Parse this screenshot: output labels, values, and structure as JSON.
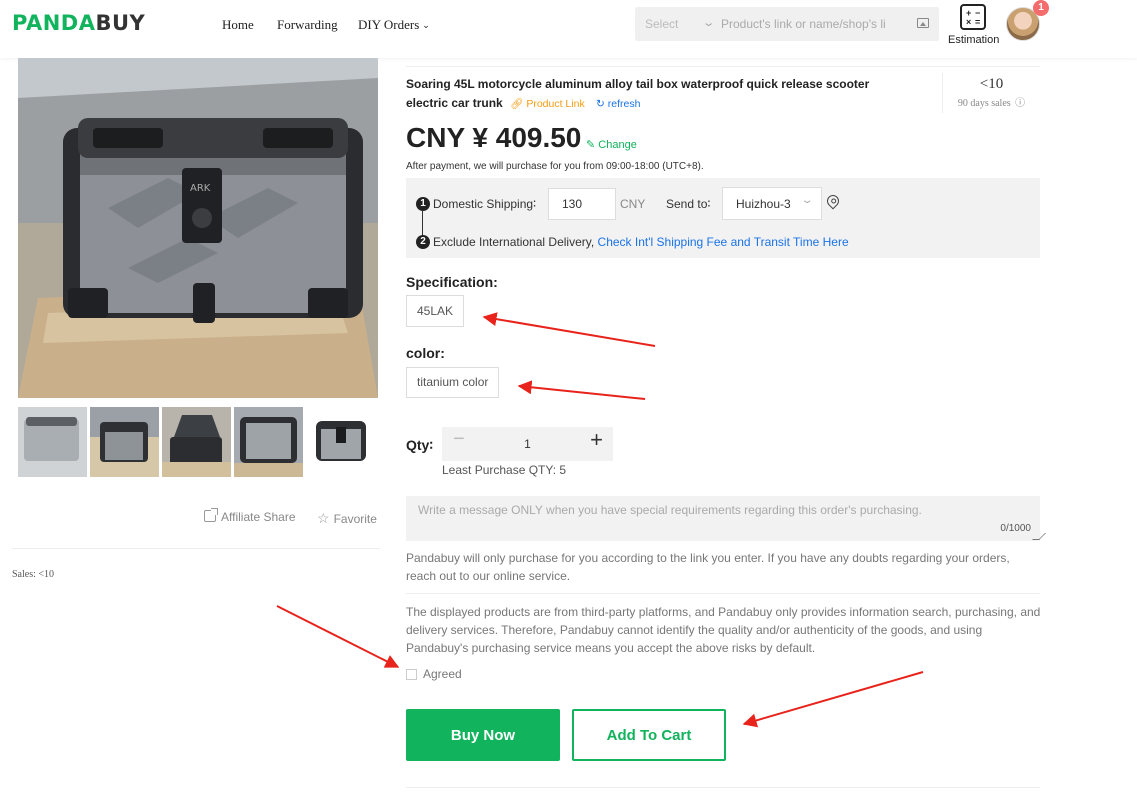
{
  "header": {
    "logo_left": "PANDA",
    "logo_right": "BUY",
    "nav": {
      "home": "Home",
      "forwarding": "Forwarding",
      "diy_orders": "DIY Orders"
    },
    "search": {
      "select_label": "Select",
      "placeholder": "Product's link or name/shop's li"
    },
    "estimation_label": "Estimation",
    "notification_count": "1"
  },
  "gallery": {
    "affiliate_share": "Affiliate Share",
    "favorite": "Favorite",
    "sales": "Sales: <10",
    "lid_mark": "ARK"
  },
  "product": {
    "title": "Soaring 45L motorcycle aluminum alloy tail box waterproof quick release scooter electric car trunk",
    "product_link": "Product Link",
    "refresh": "refresh",
    "sales_value": "<10",
    "sales_label": "90 days sales",
    "price": "CNY ¥ 409.50",
    "change": "Change",
    "after_payment": "After payment, we will purchase for you from 09:00-18:00 (UTC+8)."
  },
  "shipping": {
    "step1": "1",
    "step2": "2",
    "domestic_label": "Domestic Shipping∶",
    "domestic_value": "130",
    "currency": "CNY",
    "send_to_label": "Send to∶",
    "send_to_value": "Huizhou-3",
    "exclude_text": "Exclude International Delivery, ",
    "check_link": "Check Int'l Shipping Fee and Transit Time Here"
  },
  "specification": {
    "heading": "Specification:",
    "option": "45LAK"
  },
  "color": {
    "heading": "color:",
    "option": "titanium color"
  },
  "quantity": {
    "label": "Qty∶",
    "minus": "−",
    "value": "1",
    "plus": "+",
    "least": "Least Purchase QTY: 5"
  },
  "message": {
    "placeholder": "Write a message ONLY when you have special requirements regarding this order's purchasing.",
    "counter": "0/1000"
  },
  "notices": {
    "notice1": "Pandabuy will only purchase for you according to the link you enter. If you have any doubts regarding your orders, reach out to our online service.",
    "notice2": "The displayed products are from third-party platforms, and Pandabuy only provides information search, purchasing, and delivery services. Therefore, Pandabuy cannot identify the quality and/or authenticity of the goods, and using Pandabuy's purchasing service means you accept the above risks by default.",
    "agreed": "Agreed"
  },
  "actions": {
    "buy_now": "Buy Now",
    "add_to_cart": "Add To Cart"
  },
  "colors": {
    "brand_green": "#11b35c",
    "annotation_red": "#e8231b",
    "link_blue": "#1a73e8",
    "link_orange": "#f39c12"
  }
}
